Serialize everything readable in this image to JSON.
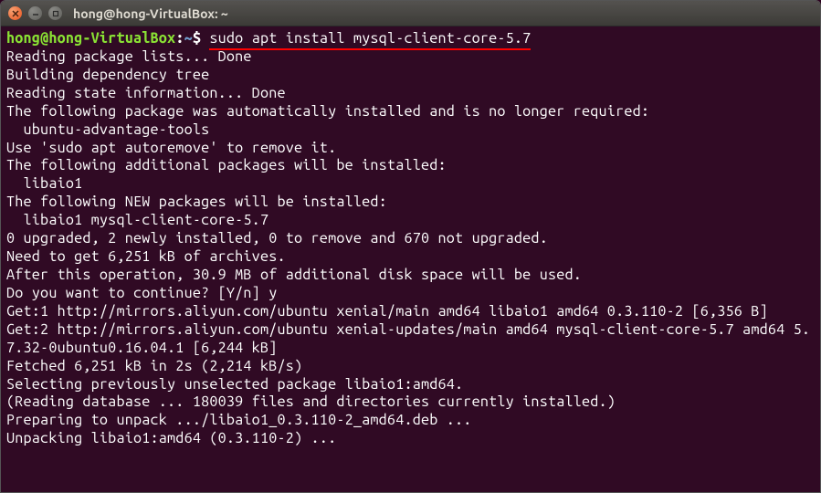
{
  "titlebar": {
    "title": "hong@hong-VirtualBox: ~"
  },
  "prompt": {
    "user": "hong",
    "at": "@",
    "host": "hong-VirtualBox",
    "colon": ":",
    "path": "~",
    "dollar": "$ "
  },
  "command": "sudo apt install mysql-client-core-5.7",
  "output": {
    "l1": "Reading package lists... Done",
    "l2": "Building dependency tree       ",
    "l3": "Reading state information... Done",
    "l4": "The following package was automatically installed and is no longer required:",
    "l5": "  ubuntu-advantage-tools",
    "l6": "Use 'sudo apt autoremove' to remove it.",
    "l7": "The following additional packages will be installed:",
    "l8": "  libaio1",
    "l9": "The following NEW packages will be installed:",
    "l10": "  libaio1 mysql-client-core-5.7",
    "l11": "0 upgraded, 2 newly installed, 0 to remove and 670 not upgraded.",
    "l12": "Need to get 6,251 kB of archives.",
    "l13": "After this operation, 30.9 MB of additional disk space will be used.",
    "l14": "Do you want to continue? [Y/n] y",
    "l15": "Get:1 http://mirrors.aliyun.com/ubuntu xenial/main amd64 libaio1 amd64 0.3.110-2 [6,356 B]",
    "l16": "Get:2 http://mirrors.aliyun.com/ubuntu xenial-updates/main amd64 mysql-client-core-5.7 amd64 5.7.32-0ubuntu0.16.04.1 [6,244 kB]",
    "l17": "Fetched 6,251 kB in 2s (2,214 kB/s)",
    "l18": "Selecting previously unselected package libaio1:amd64.",
    "l19": "(Reading database ... 180039 files and directories currently installed.)",
    "l20": "Preparing to unpack .../libaio1_0.3.110-2_amd64.deb ...",
    "l21": "Unpacking libaio1:amd64 (0.3.110-2) ..."
  }
}
